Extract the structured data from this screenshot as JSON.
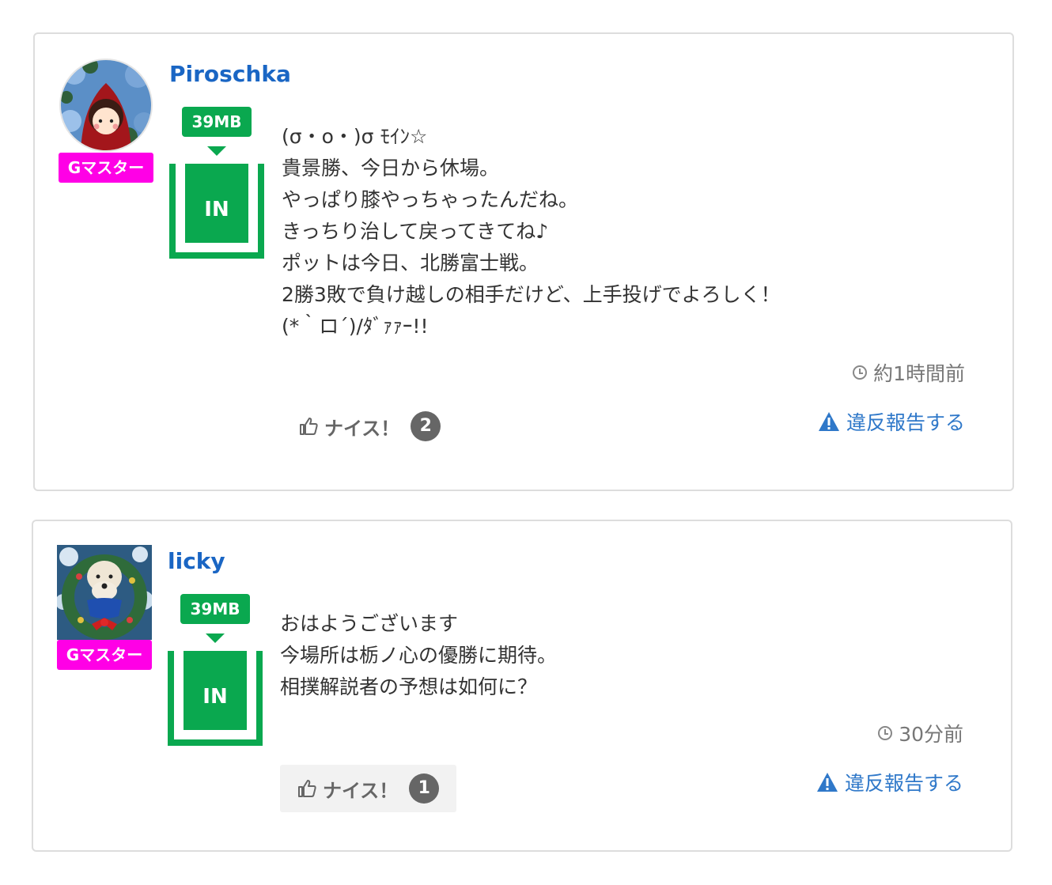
{
  "colors": {
    "username": "#1a66c4",
    "rank_badge_bg": "#ff00e6",
    "meter_green": "#0aa84f",
    "report_link": "#2f78c9"
  },
  "posts": [
    {
      "username": "Piroschka",
      "rank": "Gマスター",
      "mb": "39MB",
      "status": "IN",
      "body": "(σ・o・)σ ﾓｲﾝ☆\n貴景勝、今日から休場。\nやっぱり膝やっちゃったんだね。\nきっちり治して戻ってきてね♪\nポットは今日、北勝富士戦。\n2勝3敗で負け越しの相手だけど、上手投げでよろしく！\n(*｀ロ´)/ﾀﾞｧｧｰ!!",
      "timestamp": "約1時間前",
      "nice_label": "ナイス！",
      "nice_count": "2",
      "report_label": "違反報告する",
      "avatar_icon": "red-hood-girl-icon"
    },
    {
      "username": "licky",
      "rank": "Gマスター",
      "mb": "39MB",
      "status": "IN",
      "body": "おはようございます\n今場所は栃ノ心の優勝に期待。\n相撲解説者の予想は如何に？",
      "timestamp": "30分前",
      "nice_label": "ナイス！",
      "nice_count": "1",
      "report_label": "違反報告する",
      "avatar_icon": "dog-wreath-icon"
    }
  ]
}
